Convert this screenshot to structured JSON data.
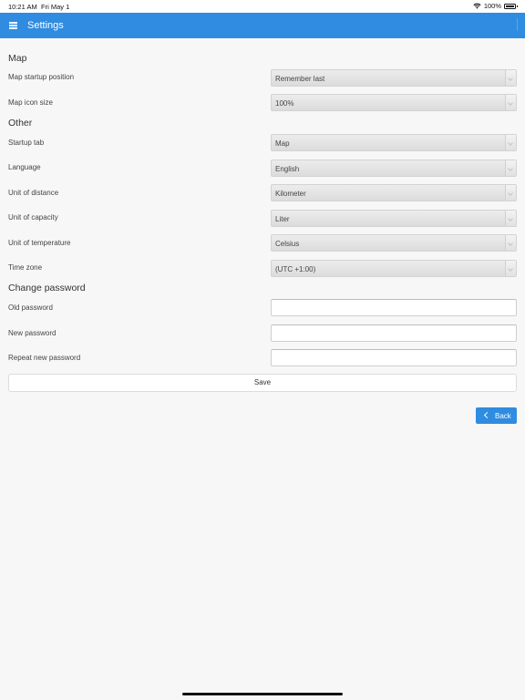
{
  "status_bar": {
    "time": "10:21 AM",
    "date": "Fri May 1",
    "battery": "100%",
    "icons": [
      "wifi-icon",
      "battery-icon"
    ]
  },
  "header": {
    "title": "Settings",
    "menu_icon": "hamburger-menu-icon",
    "accent": "#2f8ce0"
  },
  "sections": {
    "map": {
      "title": "Map",
      "startup_position": {
        "label": "Map startup position",
        "value": "Remember last"
      },
      "icon_size": {
        "label": "Map icon size",
        "value": "100%"
      }
    },
    "other": {
      "title": "Other",
      "startup_tab": {
        "label": "Startup tab",
        "value": "Map"
      },
      "language": {
        "label": "Language",
        "value": "English"
      },
      "unit_distance": {
        "label": "Unit of distance",
        "value": "Kilometer"
      },
      "unit_capacity": {
        "label": "Unit of capacity",
        "value": "Liter"
      },
      "unit_temperature": {
        "label": "Unit of temperature",
        "value": "Celsius"
      },
      "time_zone": {
        "label": "Time zone",
        "value": "(UTC +1:00)"
      }
    },
    "password": {
      "title": "Change password",
      "old": {
        "label": "Old password",
        "value": ""
      },
      "new": {
        "label": "New password",
        "value": ""
      },
      "repeat": {
        "label": "Repeat new password",
        "value": ""
      }
    }
  },
  "actions": {
    "save_label": "Save",
    "back_label": "Back",
    "back_icon": "chevron-left-icon"
  }
}
